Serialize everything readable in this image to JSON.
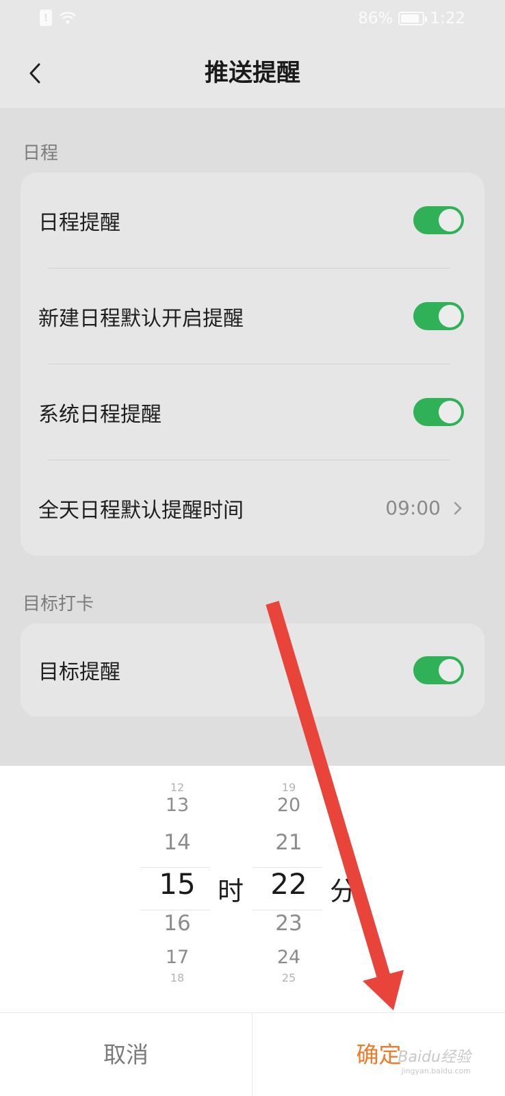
{
  "status_bar": {
    "battery": "86%",
    "time": "1:22"
  },
  "header": {
    "title": "推送提醒"
  },
  "sections": {
    "schedule": {
      "title": "日程",
      "rows": [
        {
          "label": "日程提醒",
          "toggle": true
        },
        {
          "label": "新建日程默认开启提醒",
          "toggle": true
        },
        {
          "label": "系统日程提醒",
          "toggle": true
        },
        {
          "label": "全天日程默认提醒时间",
          "value": "09:00"
        }
      ]
    },
    "goals": {
      "title": "目标打卡",
      "rows": [
        {
          "label": "目标提醒",
          "toggle": true
        }
      ]
    }
  },
  "picker": {
    "hours": [
      "12",
      "13",
      "14",
      "15",
      "16",
      "17",
      "18"
    ],
    "minutes": [
      "19",
      "20",
      "21",
      "22",
      "23",
      "24",
      "25"
    ],
    "hour_unit": "时",
    "minute_unit": "分"
  },
  "buttons": {
    "cancel": "取消",
    "confirm": "确定"
  },
  "watermark": {
    "brand": "Baidu经验",
    "url": "jingyan.baidu.com"
  },
  "colors": {
    "toggle_on": "#30b158",
    "confirm": "#ef7a2a",
    "arrow": "#e8443a"
  }
}
